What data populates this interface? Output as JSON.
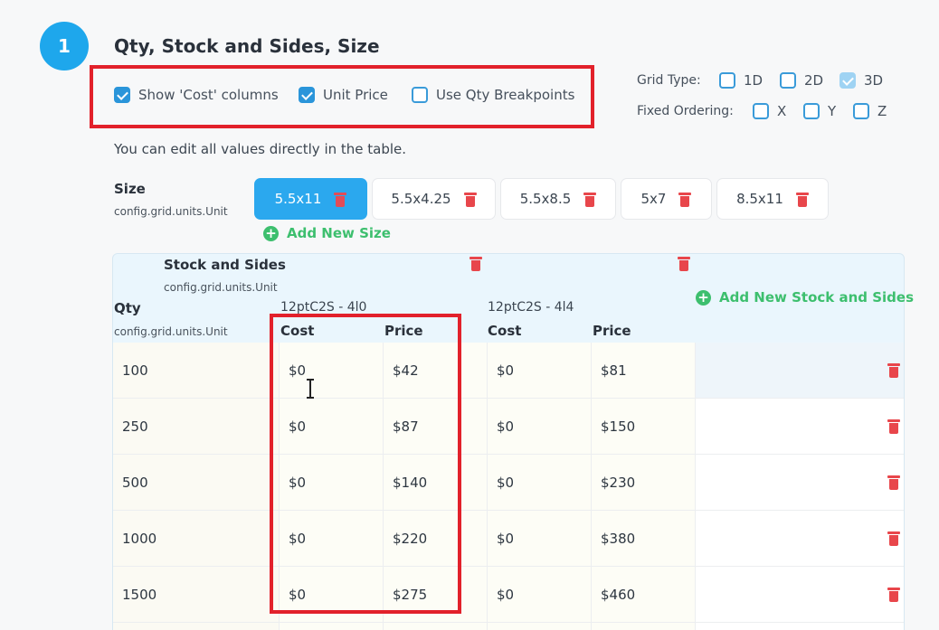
{
  "step": {
    "number": "1",
    "title": "Qty, Stock and Sides, Size"
  },
  "options": {
    "show_cost": {
      "label": "Show 'Cost' columns",
      "checked": true
    },
    "unit_price": {
      "label": "Unit Price",
      "checked": true
    },
    "qty_breakpoints": {
      "label": "Use Qty Breakpoints",
      "checked": false
    }
  },
  "grid_type": {
    "label": "Grid Type:",
    "options": [
      {
        "label": "1D",
        "checked": false
      },
      {
        "label": "2D",
        "checked": false
      },
      {
        "label": "3D",
        "checked": true
      }
    ]
  },
  "fixed_ordering": {
    "label": "Fixed Ordering:",
    "options": [
      {
        "label": "X",
        "checked": false
      },
      {
        "label": "Y",
        "checked": false
      },
      {
        "label": "Z",
        "checked": false
      }
    ]
  },
  "hint": "You can edit all values directly in the table.",
  "size": {
    "label": "Size",
    "sub": "config.grid.units.Unit",
    "tabs": [
      "5.5x11",
      "5.5x4.25",
      "5.5x8.5",
      "5x7",
      "8.5x11"
    ],
    "active_index": 0,
    "add_label": "Add New Size"
  },
  "stock": {
    "label": "Stock and Sides",
    "sub": "config.grid.units.Unit",
    "columns": [
      "12ptC2S - 4l0",
      "12ptC2S - 4l4"
    ],
    "add_label": "Add New Stock and Sides"
  },
  "qty": {
    "label": "Qty",
    "sub": "config.grid.units.Unit"
  },
  "headers": {
    "cost": "Cost",
    "price": "Price"
  },
  "rows": [
    {
      "qty": "100",
      "cost1": "$0",
      "price1": "$42",
      "cost2": "$0",
      "price2": "$81"
    },
    {
      "qty": "250",
      "cost1": "$0",
      "price1": "$87",
      "cost2": "$0",
      "price2": "$150"
    },
    {
      "qty": "500",
      "cost1": "$0",
      "price1": "$140",
      "cost2": "$0",
      "price2": "$230"
    },
    {
      "qty": "1000",
      "cost1": "$0",
      "price1": "$220",
      "cost2": "$0",
      "price2": "$380"
    },
    {
      "qty": "1500",
      "cost1": "$0",
      "price1": "$275",
      "cost2": "$0",
      "price2": "$460"
    }
  ],
  "colors": {
    "accent": "#1ea7ec",
    "add": "#3dbf6e",
    "danger": "#e8464b",
    "highlight": "#e2212b"
  }
}
